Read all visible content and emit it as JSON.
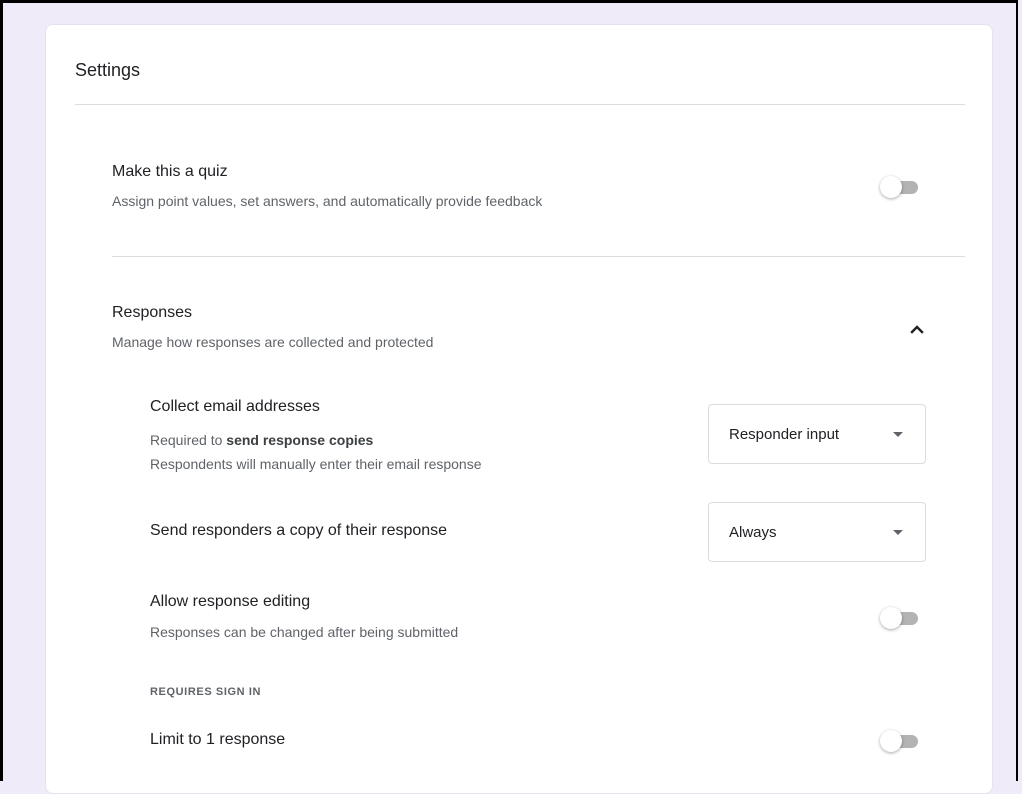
{
  "settings": {
    "title": "Settings",
    "quiz": {
      "title": "Make this a quiz",
      "description": "Assign point values, set answers, and automatically provide feedback",
      "enabled": false
    },
    "responses": {
      "title": "Responses",
      "description": "Manage how responses are collected and protected",
      "expanded": true,
      "collect_email": {
        "title": "Collect email addresses",
        "desc_prefix": "Required to ",
        "desc_bold": "send response copies",
        "desc_line2": "Respondents will manually enter their email response",
        "selected": "Responder input"
      },
      "send_copy": {
        "title": "Send responders a copy of their response",
        "selected": "Always"
      },
      "allow_editing": {
        "title": "Allow response editing",
        "description": "Responses can be changed after being submitted",
        "enabled": false
      },
      "requires_sign_in_caption": "REQUIRES SIGN IN",
      "limit_one": {
        "title": "Limit to 1 response",
        "enabled": false
      }
    }
  },
  "icons": {
    "toggle": "switch-off",
    "chevron": "chevron-up-icon",
    "caret": "dropdown-caret-icon"
  },
  "colors": {
    "page_background": "#f0ebf8",
    "card_background": "#ffffff",
    "divider": "#dadce0",
    "primary_text": "#202124",
    "secondary_text": "#5f6368",
    "toggle_track_off": "#b3b3b3"
  }
}
